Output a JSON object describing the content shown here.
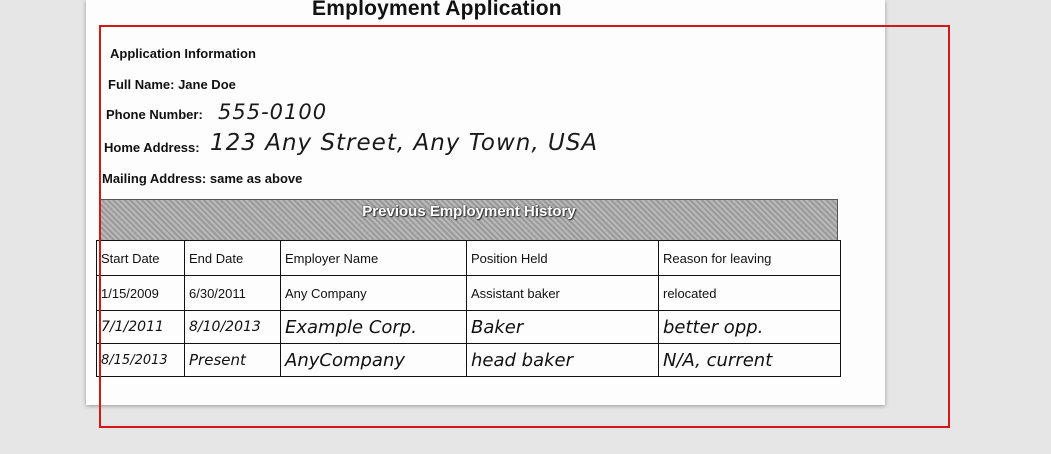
{
  "document": {
    "title": "Employment Application",
    "application_info": {
      "heading": "Application Information",
      "full_name_label": "Full Name: Jane Doe",
      "phone_label": "Phone Number:",
      "phone_value": "555-0100",
      "home_address_label": "Home Address:",
      "home_address_value": "123 Any Street, Any Town, USA",
      "mailing_address_label": "Mailing Address: same as above"
    },
    "employment_history": {
      "heading": "Previous Employment History",
      "columns": [
        "Start Date",
        "End Date",
        "Employer Name",
        "Position Held",
        "Reason for leaving"
      ],
      "rows": [
        [
          "1/15/2009",
          "6/30/2011",
          "Any Company",
          "Assistant baker",
          "relocated"
        ],
        [
          "7/1/2011",
          "8/10/2013",
          "Example Corp.",
          "Baker",
          "better opp."
        ],
        [
          "8/15/2013",
          "Present",
          "AnyCompany",
          "head baker",
          "N/A, current"
        ]
      ]
    }
  },
  "colors": {
    "selection_box": "#d41818",
    "page_background": "#e6e6e6",
    "band_grey": "#a8a8a8"
  }
}
